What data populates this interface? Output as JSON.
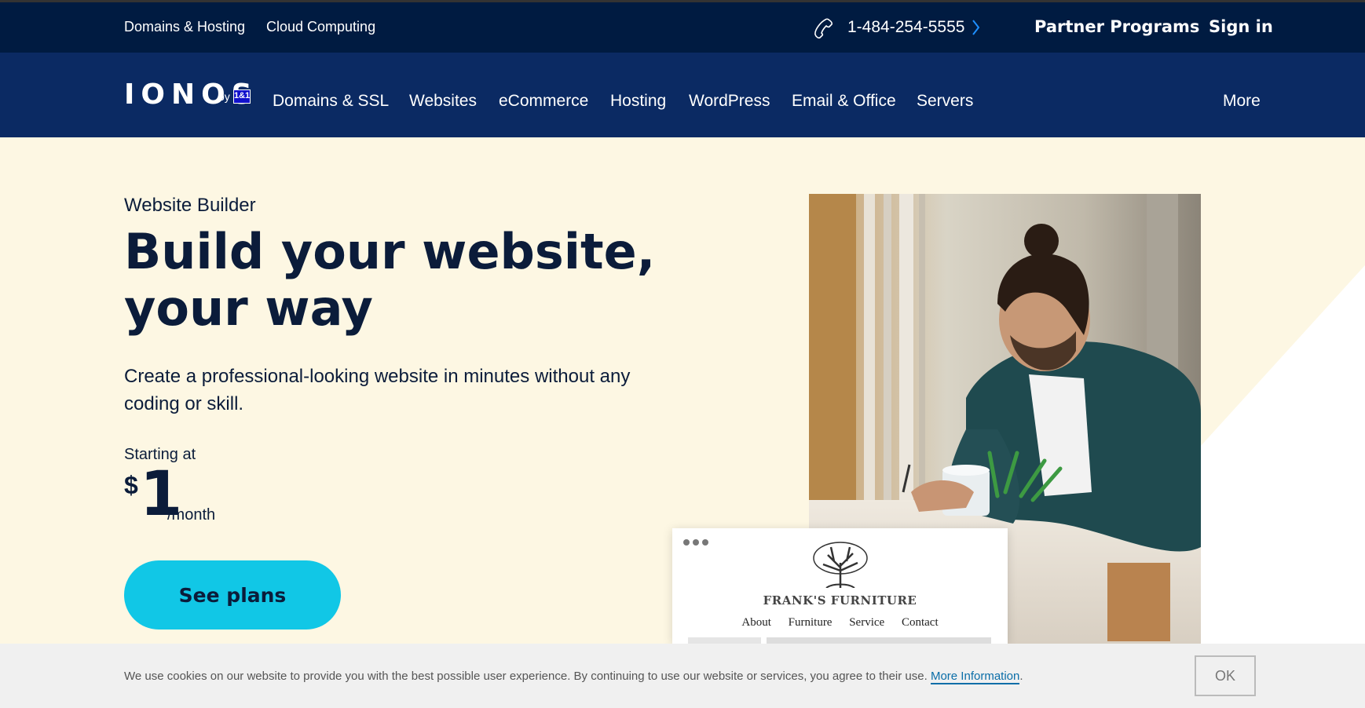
{
  "topbar": {
    "tabs": [
      {
        "label": "Domains & Hosting",
        "active": true
      },
      {
        "label": "Cloud Computing",
        "active": false
      }
    ],
    "phone": "1-484-254-5555",
    "partner_programs": "Partner Programs",
    "sign_in": "Sign in"
  },
  "logo": {
    "name": "IONOS",
    "by": "by",
    "brand_mark": "1&1"
  },
  "nav": {
    "items": [
      "Domains & SSL",
      "Websites",
      "eCommerce",
      "Hosting",
      "WordPress",
      "Email & Office",
      "Servers"
    ],
    "more": "More"
  },
  "hero": {
    "eyebrow": "Website Builder",
    "title_line1": "Build your website,",
    "title_line2": "your way",
    "subtitle": "Create a professional-looking website in minutes without any coding or skill.",
    "price_lead": "Starting at",
    "currency": "$",
    "price": "1",
    "period": "/month",
    "cta": "See plans"
  },
  "mockup": {
    "brand": "FRANK'S FURNITURE",
    "links": [
      "About",
      "Furniture",
      "Service",
      "Contact"
    ]
  },
  "cookie": {
    "text": "We use cookies on our website to provide you with the best possible user experience. By continuing to use our website or services, you agree to their use.",
    "link": "More Information",
    "suffix": ".",
    "ok": "OK"
  },
  "colors": {
    "topbar_bg": "#001b41",
    "nav_bg": "#0b2a63",
    "hero_bg": "#fdf7e3",
    "cta_bg": "#11c7e6",
    "text_dark": "#0b1c3a"
  }
}
